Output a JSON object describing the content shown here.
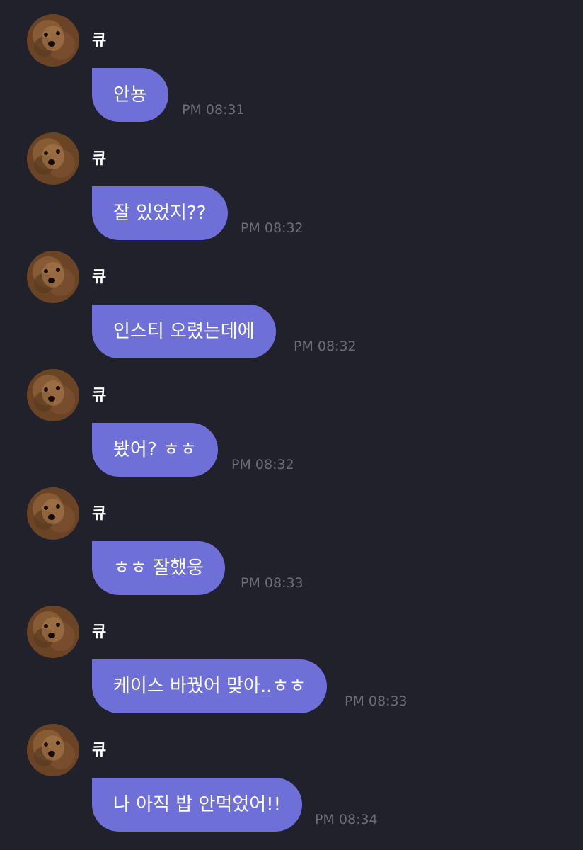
{
  "theme": {
    "background": "#21212b",
    "bubble_color": "#6f70d7",
    "text_color": "#ffffff",
    "timestamp_color": "#6d6d7a"
  },
  "avatar_icon": "dog-photo-avatar",
  "messages": [
    {
      "sender": "큐",
      "text": "안뇽",
      "time": "PM 08:31"
    },
    {
      "sender": "큐",
      "text": "잘 있었지??",
      "time": "PM 08:32"
    },
    {
      "sender": "큐",
      "text": "인스티 오렸는데에",
      "time": "PM 08:32"
    },
    {
      "sender": "큐",
      "text": "봤어? ㅎㅎ",
      "time": "PM 08:32"
    },
    {
      "sender": "큐",
      "text": "ㅎㅎ 잘했웅",
      "time": "PM 08:33"
    },
    {
      "sender": "큐",
      "text": "케이스 바꿨어 맞아..ㅎㅎ",
      "time": "PM 08:33"
    },
    {
      "sender": "큐",
      "text": "나 아직 밥 안먹었어!!",
      "time": "PM 08:34"
    }
  ]
}
